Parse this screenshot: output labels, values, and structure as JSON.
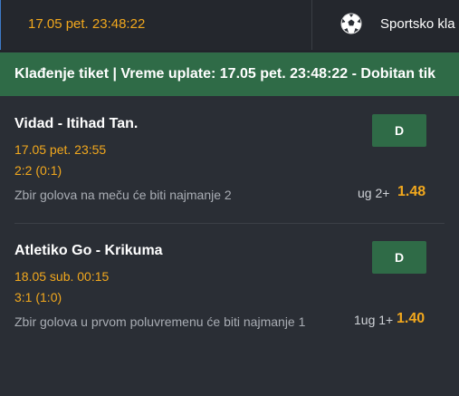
{
  "header": {
    "datetime": "17.05 pet. 23:48:22",
    "sport_label": "Sportsko kla",
    "sport_icon": "soccer-ball-icon"
  },
  "banner": {
    "text": "Klađenje tiket | Vreme uplate: 17.05 pet. 23:48:22 - Dobitan tik"
  },
  "bets": [
    {
      "match": "Vidad - Itihad Tan.",
      "time": "17.05 pet. 23:55",
      "score": "2:2 (0:1)",
      "market": "Zbir golova na meču će biti najmanje 2",
      "pick": "ug 2+",
      "odd": "1.48",
      "status": "D"
    },
    {
      "match": "Atletiko Go - Krikuma",
      "time": "18.05 sub. 00:15",
      "score": "3:1 (1:0)",
      "market": "Zbir golova u prvom poluvremenu će biti najmanje 1",
      "pick": "1ug 1+",
      "odd": "1.40",
      "status": "D"
    }
  ],
  "colors": {
    "accent": "#f2a81d",
    "win_green": "#2f6b47",
    "background": "#2a2e35"
  }
}
